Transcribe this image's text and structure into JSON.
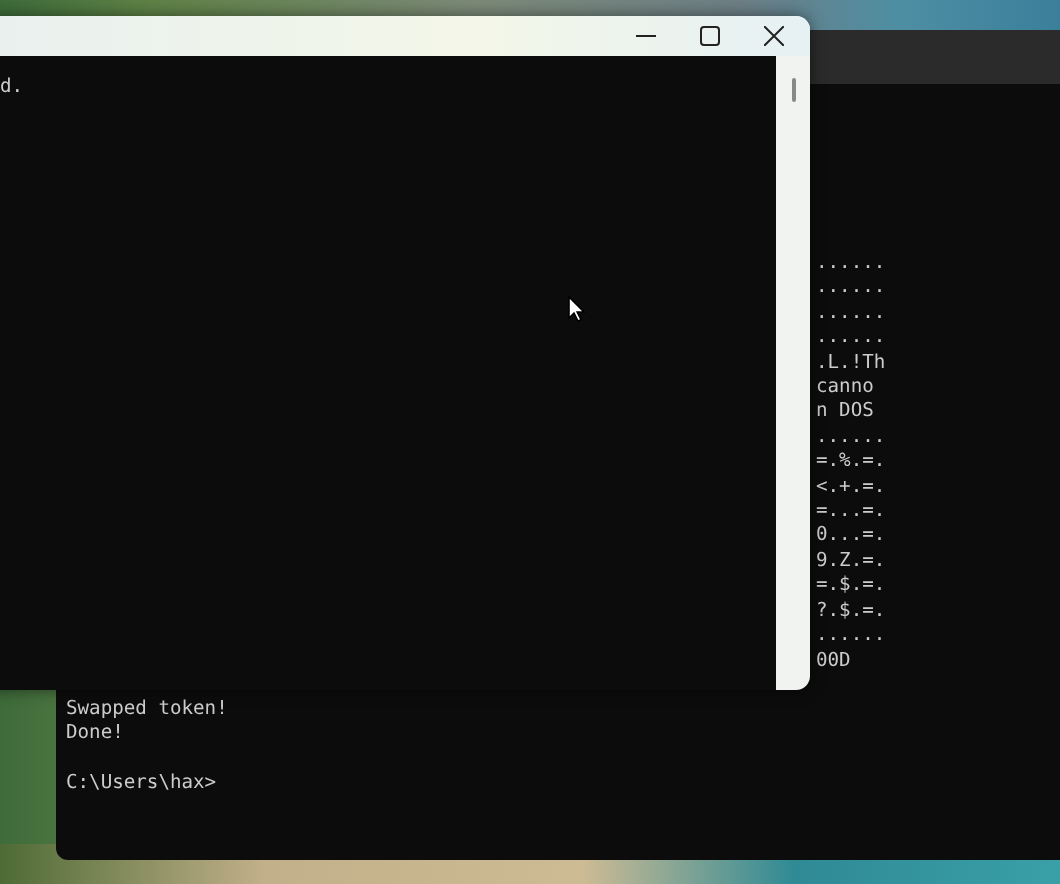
{
  "back_window": {
    "partial_lines": [
      "......",
      "......",
      "......",
      "......",
      ".L.!Th",
      "canno",
      "n DOS",
      "......",
      "=.%.=.",
      "<.+.=.",
      "=...=.",
      "0...=.",
      "9.Z.=.",
      "=.$.=.",
      "?.$.=.",
      "......",
      "00D"
    ],
    "lines": [
      "Swapped token!",
      "Done!"
    ],
    "prompt": "C:\\Users\\hax>"
  },
  "front_window": {
    "lines": [
      "d."
    ]
  }
}
